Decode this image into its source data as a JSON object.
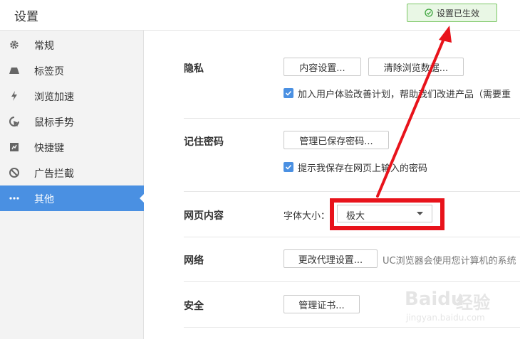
{
  "header": {
    "title": "设置",
    "toast": "设置已生效"
  },
  "sidebar": {
    "items": [
      {
        "label": "常规",
        "icon": "gear-icon"
      },
      {
        "label": "标签页",
        "icon": "tab-icon"
      },
      {
        "label": "浏览加速",
        "icon": "lightning-icon"
      },
      {
        "label": "鼠标手势",
        "icon": "mouse-pointer-icon"
      },
      {
        "label": "快捷键",
        "icon": "keyboard-icon"
      },
      {
        "label": "广告拦截",
        "icon": "block-icon"
      },
      {
        "label": "其他",
        "icon": "more-icon",
        "active": true
      }
    ]
  },
  "privacy": {
    "label": "隐私",
    "content_settings_button": "内容设置...",
    "clear_data_button": "清除浏览数据...",
    "ux_program_checkbox": "加入用户体验改善计划，帮助我们改进产品（需要重"
  },
  "passwords": {
    "label": "记住密码",
    "manage_button": "管理已保存密码...",
    "prompt_checkbox": "提示我保存在网页上输入的密码"
  },
  "webcontent": {
    "label": "网页内容",
    "font_size_label": "字体大小：",
    "font_size_value": "极大"
  },
  "network": {
    "label": "网络",
    "proxy_button": "更改代理设置...",
    "proxy_note": "UC浏览器会使用您计算机的系统"
  },
  "security": {
    "label": "安全",
    "certs_button": "管理证书..."
  },
  "watermark": {
    "brand": "Baidu",
    "brand_cn": "经验",
    "url": "jingyan.baidu.com"
  },
  "colors": {
    "accent": "#4a90e2",
    "annotation_red": "#e8131b",
    "toast_border": "#7cc766"
  }
}
